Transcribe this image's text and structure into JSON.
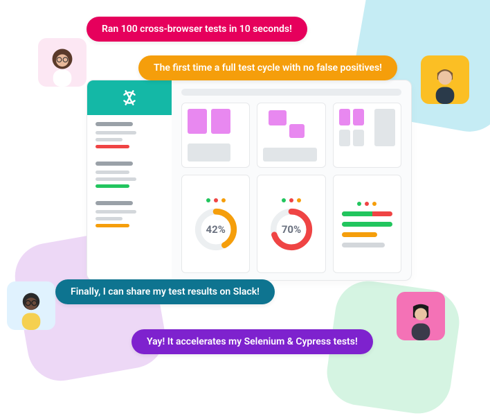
{
  "bubbles": {
    "b1": "Ran 100 cross-browser tests in 10 seconds!",
    "b2": "The first time a full test cycle with no false positives!",
    "b3": "Finally, I can share my test results on Slack!",
    "b4": "Yay! It accelerates my Selenium & Cypress tests!"
  },
  "chart_data": [
    {
      "type": "pie",
      "title": "",
      "values": [
        42,
        58
      ],
      "display": "42%"
    },
    {
      "type": "pie",
      "title": "",
      "values": [
        70,
        30
      ],
      "display": "70%"
    }
  ],
  "stats": {
    "donut1_label": "42%",
    "donut2_label": "70%"
  },
  "colors": {
    "teal": "#14b8a6",
    "pink": "#e6005c",
    "amber": "#f59e0b",
    "tealdark": "#0e7490",
    "purple": "#7e22ce",
    "magenta_tile": "#e888f0",
    "green": "#22c55e",
    "red": "#ef4444"
  }
}
